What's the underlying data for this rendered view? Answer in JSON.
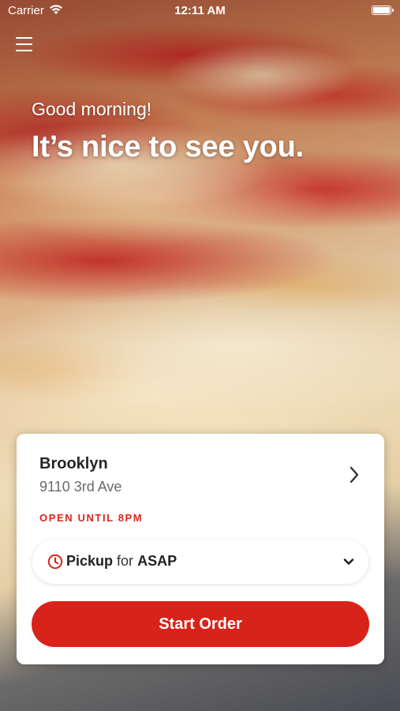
{
  "status_bar": {
    "carrier": "Carrier",
    "time": "12:11 AM"
  },
  "icons": {
    "menu": "hamburger-menu-icon",
    "wifi": "wifi-icon",
    "battery": "battery-icon",
    "store_chevron": "chevron-right-icon",
    "clock": "clock-icon",
    "dropdown": "chevron-down-icon"
  },
  "hero": {
    "greeting": "Good morning!",
    "headline": "It’s nice to see you."
  },
  "store": {
    "name": "Brooklyn",
    "address": "9110 3rd Ave",
    "hours": "OPEN UNTIL 8PM"
  },
  "order": {
    "method": "Pickup",
    "connector": "for",
    "time": "ASAP",
    "start_label": "Start Order"
  },
  "colors": {
    "accent": "#d8231a",
    "text_dark": "#262626",
    "text_muted": "#6a6a6a"
  }
}
